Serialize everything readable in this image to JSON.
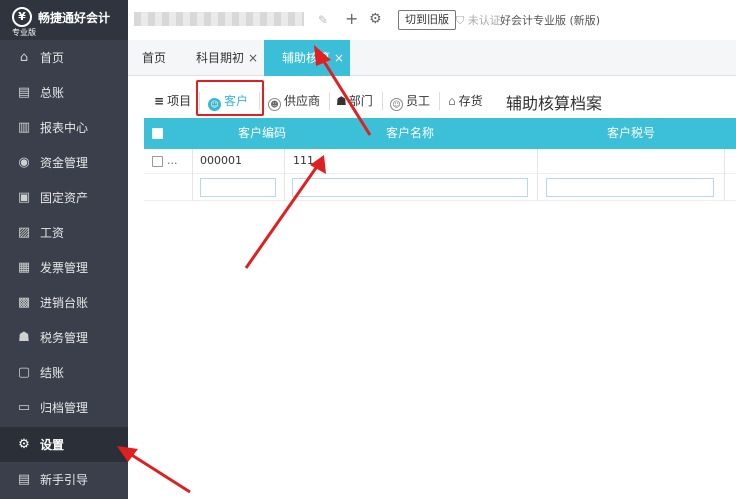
{
  "app": {
    "logo_mark": "¥",
    "title": "畅捷通好会计",
    "edition": "专业版"
  },
  "sidebar": {
    "items": [
      {
        "label": "首页",
        "icon": "home-icon",
        "glyph": "⌂"
      },
      {
        "label": "总账",
        "icon": "ledger-icon",
        "glyph": "▤"
      },
      {
        "label": "报表中心",
        "icon": "chart-icon",
        "glyph": "▥"
      },
      {
        "label": "资金管理",
        "icon": "money-icon",
        "glyph": "◉"
      },
      {
        "label": "固定资产",
        "icon": "asset-icon",
        "glyph": "▣"
      },
      {
        "label": "工资",
        "icon": "salary-icon",
        "glyph": "▨"
      },
      {
        "label": "发票管理",
        "icon": "invoice-icon",
        "glyph": "▦"
      },
      {
        "label": "进销台账",
        "icon": "inventory-icon",
        "glyph": "▩"
      },
      {
        "label": "税务管理",
        "icon": "tax-icon",
        "glyph": "☗"
      },
      {
        "label": "结账",
        "icon": "close-books-icon",
        "glyph": "▢"
      },
      {
        "label": "归档管理",
        "icon": "archive-icon",
        "glyph": "▭"
      },
      {
        "label": "设置",
        "icon": "gear-icon",
        "glyph": "⚙",
        "active": true
      },
      {
        "label": "新手引导",
        "icon": "guide-icon",
        "glyph": "▤"
      }
    ]
  },
  "topbar": {
    "add_glyph": "+",
    "settings_glyph": "⚙",
    "switch_old_label": "切到旧版",
    "auth_label": "未认证",
    "version_label": "好会计专业版 (新版)"
  },
  "tabs": [
    {
      "label": "首页"
    },
    {
      "label": "科目期初",
      "close": "×"
    },
    {
      "label": "辅助核算",
      "close": "×",
      "active": true
    }
  ],
  "subtabs": [
    {
      "label": "项目",
      "glyph": "≡"
    },
    {
      "label": "客户",
      "glyph": "☺",
      "active": true
    },
    {
      "label": "供应商",
      "glyph": "☻"
    },
    {
      "label": "部门",
      "glyph": "☗"
    },
    {
      "label": "员工",
      "glyph": "☺"
    },
    {
      "label": "存货",
      "glyph": "⌂"
    }
  ],
  "panel_title": "辅助核算档案",
  "table": {
    "columns": [
      "客户编码",
      "客户名称",
      "客户税号"
    ],
    "rows": [
      {
        "more": "...",
        "code": "000001",
        "name": "111",
        "tax": ""
      }
    ],
    "filter_inputs": [
      "",
      "",
      ""
    ]
  },
  "colors": {
    "accent": "#3bc0d8",
    "sidebar_bg": "#3a3f4b",
    "highlight_red": "#e02020"
  }
}
